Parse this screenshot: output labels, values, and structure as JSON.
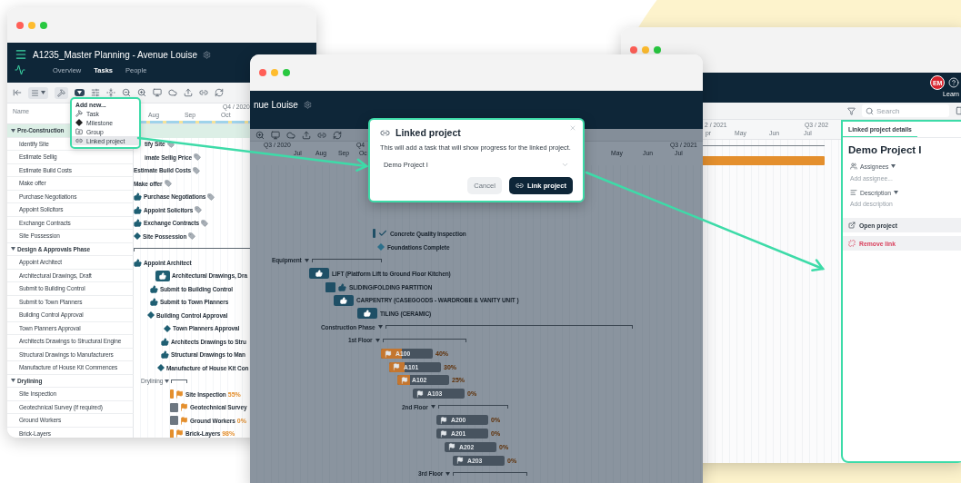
{
  "planner_window": {
    "title": "A1235_Master Planning - Avenue Louise",
    "tabs": [
      {
        "label": "Overview",
        "selected": false
      },
      {
        "label": "Tasks",
        "selected": true
      },
      {
        "label": "People",
        "selected": false
      }
    ],
    "name_header": "Name",
    "quarter": "Q4 / 2020",
    "months": [
      "Aug",
      "Sep",
      "Oct"
    ],
    "add_menu": {
      "heading": "Add new...",
      "items": [
        {
          "kind": "task",
          "label": "Task",
          "selected": false
        },
        {
          "kind": "milestone",
          "label": "Milestone",
          "selected": false
        },
        {
          "kind": "group",
          "label": "Group",
          "selected": false
        },
        {
          "kind": "linked",
          "label": "Linked project",
          "selected": true
        }
      ]
    },
    "rows": [
      {
        "name": "Pre-Construction",
        "kind": "group",
        "selected": true
      },
      {
        "name": "Identify Site",
        "kind": "task",
        "selected": false,
        "bar": {
          "kind": "plain",
          "label": "tify Site",
          "tagged": true
        }
      },
      {
        "name": "Estimate Sellig",
        "kind": "task",
        "selected": false,
        "bar": {
          "kind": "plain",
          "label": "imate Sellig Price",
          "tagged": true
        }
      },
      {
        "name": "Estimate Build Costs",
        "kind": "task",
        "selected": false,
        "bar": {
          "kind": "plain",
          "label": "Estimate Build Costs",
          "tagged": true
        }
      },
      {
        "name": "Make offer",
        "kind": "task",
        "selected": false,
        "bar": {
          "kind": "plain",
          "label": "Make offer",
          "tagged": true
        }
      },
      {
        "name": "Purchase Negotiations",
        "kind": "task",
        "selected": false,
        "bar": {
          "kind": "thumb",
          "label": "Purchase Negotiations",
          "tagged": true
        }
      },
      {
        "name": "Appoint Solicitors",
        "kind": "task",
        "selected": false,
        "bar": {
          "kind": "thumb",
          "label": "Appoint Solicitors",
          "tagged": true
        }
      },
      {
        "name": "Exchange Contracts",
        "kind": "task",
        "selected": false,
        "bar": {
          "kind": "thumb",
          "label": "Exchange Contracts",
          "tagged": true
        }
      },
      {
        "name": "Site Possession",
        "kind": "task",
        "selected": false,
        "bar": {
          "kind": "milestone",
          "label": "Site Possession",
          "tagged": true
        }
      },
      {
        "name": "Design & Approvals Phase",
        "kind": "group",
        "selected": false,
        "bar": {
          "kind": "bracket",
          "tagged": false
        }
      },
      {
        "name": "Appoint Architect",
        "kind": "task",
        "selected": false,
        "bar": {
          "kind": "thumb",
          "label": "Appoint Architect",
          "tagged": false
        }
      },
      {
        "name": "Architectural Drawings, Draft",
        "kind": "task",
        "selected": false,
        "bar": {
          "kind": "boxed",
          "label": "Architectural Drawings, Dra",
          "tagged": false
        }
      },
      {
        "name": "Submit to Building Control",
        "kind": "task",
        "selected": false,
        "bar": {
          "kind": "thumb",
          "label": "Submit to Building Control",
          "tagged": false
        }
      },
      {
        "name": "Submit to Town Planners",
        "kind": "task",
        "selected": false,
        "bar": {
          "kind": "thumb",
          "label": "Submit to Town Planners",
          "tagged": false
        }
      },
      {
        "name": "Building Control Approval",
        "kind": "task",
        "selected": false,
        "bar": {
          "kind": "milestone",
          "label": "Building Control Approval",
          "tagged": false
        }
      },
      {
        "name": "Town Planners Approval",
        "kind": "task",
        "selected": false,
        "bar": {
          "kind": "milestone",
          "label": "Town Planners Approval",
          "tagged": false
        }
      },
      {
        "name": "Architects Drawings to Structural Engine",
        "kind": "task",
        "selected": false,
        "bar": {
          "kind": "thumb",
          "label": "Architects Drawings to Stru",
          "tagged": false
        }
      },
      {
        "name": "Structural Drawings to Manufacturers",
        "kind": "task",
        "selected": false,
        "bar": {
          "kind": "thumb",
          "label": "Structural Drawings to Man",
          "tagged": false
        }
      },
      {
        "name": "Manufacture of House Kit Commences",
        "kind": "task",
        "selected": false,
        "bar": {
          "kind": "milestone",
          "label": "Manufacture of House Kit Con",
          "tagged": false
        }
      },
      {
        "name": "Drylining",
        "kind": "group",
        "selected": false,
        "bar": {
          "kind": "bracket",
          "label": "Drylining",
          "tagged": false
        }
      },
      {
        "name": "Site Inspection",
        "kind": "task",
        "selected": false,
        "bar": {
          "kind": "flag",
          "label": "Site Inspection",
          "progress": "55%",
          "tagged": false
        }
      },
      {
        "name": "Geotechnical Survey (if required)",
        "kind": "task",
        "selected": false,
        "bar": {
          "kind": "pending",
          "label": "Geotechnical Survey",
          "tagged": false
        }
      },
      {
        "name": "Ground Workers",
        "kind": "task",
        "selected": false,
        "bar": {
          "kind": "pending",
          "label": "Ground Workers",
          "progress": "0%",
          "tagged": false
        }
      },
      {
        "name": "Brick-Layers",
        "kind": "task",
        "selected": false,
        "bar": {
          "kind": "flag",
          "label": "Brick-Layers",
          "progress": "98%",
          "tagged": false
        }
      }
    ]
  },
  "timeline_window": {
    "header_title": "nue Louise",
    "quarters": [
      "Q3 / 2020",
      "Q4"
    ],
    "months_left": [
      "Jul",
      "Aug",
      "Sep",
      "Oc"
    ],
    "months_right": [
      "May",
      "Jun",
      "Jul"
    ],
    "quarter_right": "Q3 / 2021",
    "dialog": {
      "title": "Linked project",
      "message": "This will add a task that will show progress for the linked project.",
      "project": "Demo Project I",
      "cancel": "Cancel",
      "confirm": "Link project"
    },
    "rows": [
      {
        "kind": "check",
        "label": "Concrete Quality Inspection"
      },
      {
        "kind": "milestone",
        "label": "Foundations Complete"
      },
      {
        "kind": "group",
        "label": "Equipment"
      },
      {
        "kind": "thumb-bar",
        "label": "LIFT (Platform Lift to Ground Floor Kitchen)"
      },
      {
        "kind": "thumb-square",
        "label": "SLIDING/FOLDING PARTITION"
      },
      {
        "kind": "thumb-bar",
        "label": "CARPENTRY (CASEGOODS - WARDROBE & VANITY UNIT )"
      },
      {
        "kind": "thumb-bar",
        "label": "TILING (CERAMIC)"
      },
      {
        "kind": "group",
        "label": "Construction Phase"
      },
      {
        "kind": "group",
        "label": "1st Floor"
      },
      {
        "kind": "progress",
        "label": "A100",
        "progress": "40%",
        "level": 0.4
      },
      {
        "kind": "progress",
        "label": "A101",
        "progress": "30%",
        "level": 0.3
      },
      {
        "kind": "progress",
        "label": "A102",
        "progress": "25%",
        "level": 0.25
      },
      {
        "kind": "progress",
        "label": "A103",
        "progress": "0%",
        "level": 0
      },
      {
        "kind": "group",
        "label": "2nd Floor"
      },
      {
        "kind": "progress",
        "label": "A200",
        "progress": "0%",
        "level": 0
      },
      {
        "kind": "progress",
        "label": "A201",
        "progress": "0%",
        "level": 0
      },
      {
        "kind": "progress",
        "label": "A202",
        "progress": "0%",
        "level": 0
      },
      {
        "kind": "progress",
        "label": "A203",
        "progress": "0%",
        "level": 0
      },
      {
        "kind": "group",
        "label": "3rd Floor"
      }
    ]
  },
  "details_window": {
    "avatar": "EM",
    "help_link": "Learn",
    "search": {
      "placeholder": "Search"
    },
    "quarters": [
      "2 / 2021",
      "Q3 / 202"
    ],
    "months": [
      "pr",
      "May",
      "Jun",
      "Jul"
    ],
    "panel": {
      "tabs": [
        {
          "label": "Linked project details",
          "selected": true
        }
      ],
      "title": "Demo Project I",
      "assignees_label": "Assignees",
      "assignee_placeholder": "Add assignee...",
      "description_label": "Description",
      "description_placeholder": "Add description",
      "actions": [
        {
          "kind": "open",
          "label": "Open project"
        },
        {
          "kind": "remove",
          "label": "Remove link"
        }
      ]
    }
  }
}
